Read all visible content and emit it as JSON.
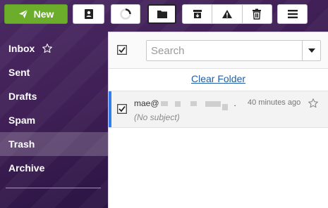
{
  "toolbar": {
    "new_label": "New"
  },
  "sidebar": {
    "items": [
      {
        "label": "Inbox"
      },
      {
        "label": "Sent"
      },
      {
        "label": "Drafts"
      },
      {
        "label": "Spam"
      },
      {
        "label": "Trash"
      },
      {
        "label": "Archive"
      }
    ],
    "active": "Trash"
  },
  "search": {
    "placeholder": "Search"
  },
  "folder": {
    "clear_label": "Clear Folder"
  },
  "messages": [
    {
      "from_prefix": "mae@",
      "from_suffix": ".",
      "time": "40 minutes ago",
      "subject": "(No subject)",
      "selected": true
    }
  ],
  "colors": {
    "new_button": "#6cae2c",
    "accent": "#2f80ed",
    "link": "#1f5fa8"
  }
}
